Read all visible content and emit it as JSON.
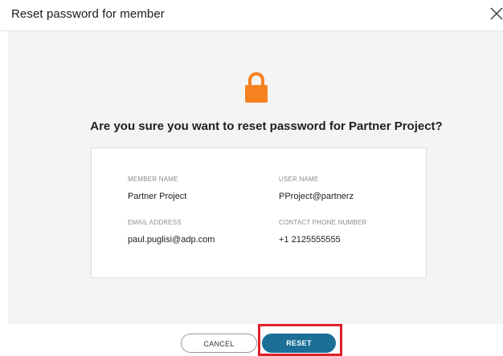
{
  "header": {
    "title": "Reset password for member"
  },
  "body": {
    "icon": "lock-icon",
    "icon_color": "#f58220",
    "question": "Are you sure you want to reset password for Partner Project?"
  },
  "details": {
    "member_name_label": "MEMBER NAME",
    "member_name_value": "Partner Project",
    "user_name_label": "USER NAME",
    "user_name_value": "PProject@partnerz",
    "email_label": "EMAIL ADDRESS",
    "email_value": "paul.puglisi@adp.com",
    "phone_label": "CONTACT PHONE NUMBER",
    "phone_value": "+1 2125555555"
  },
  "footer": {
    "cancel_label": "CANCEL",
    "reset_label": "RESET",
    "reset_color": "#1b6f96",
    "highlight_color": "#e0202a"
  }
}
